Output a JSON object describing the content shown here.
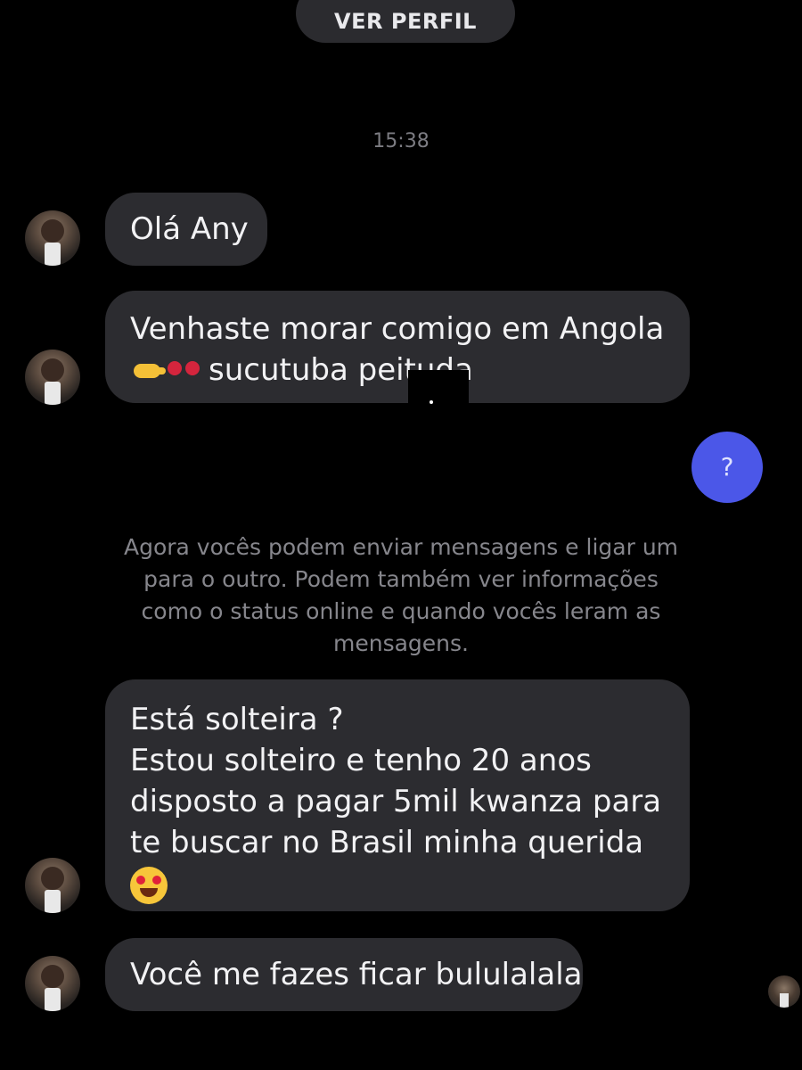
{
  "header": {
    "view_profile_label": "VER PERFIL"
  },
  "conversation": {
    "timestamp": "15:38",
    "messages": [
      {
        "side": "incoming",
        "lines": [
          "Olá Any"
        ]
      },
      {
        "side": "incoming",
        "lines": [
          "Venhaste morar comigo em Angola",
          "sucutuba peituda"
        ]
      },
      {
        "side": "outgoing",
        "lines": [
          "?"
        ]
      },
      {
        "side": "incoming",
        "lines": [
          "Está solteira ?",
          "Estou solteiro e tenho 20 anos",
          "disposto a pagar 5mil kwanza para",
          "te buscar no Brasil minha querida"
        ]
      },
      {
        "side": "incoming",
        "lines": [
          "Você me fazes ficar bululalala"
        ]
      }
    ],
    "system_note_lines": [
      "Agora vocês podem enviar mensagens e ligar um",
      "para o outro. Podem também ver informações",
      "como o status online e quando vocês leram as",
      "mensagens."
    ]
  },
  "icons": {
    "emoji_1": "pointing-right-emoji",
    "emoji_2": "bikini-emoji",
    "emoji_3": "heart-eyes-emoji"
  },
  "colors": {
    "background": "#000000",
    "incoming_bubble": "#2c2c30",
    "outgoing_bubble": "#4b57e8",
    "system_text": "#86868c"
  }
}
